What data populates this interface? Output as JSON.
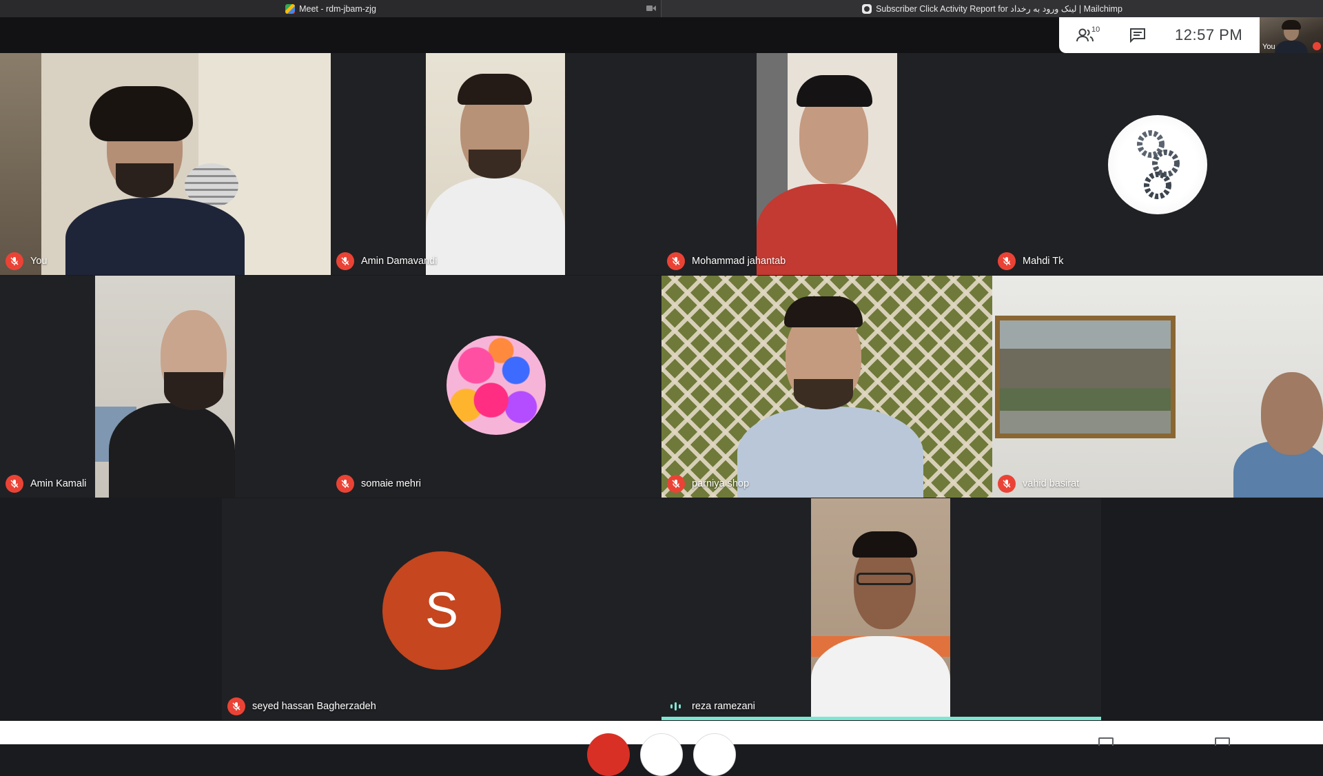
{
  "browser": {
    "tabs": [
      {
        "title": "Meet - rdm-jbam-zjg",
        "active": true
      },
      {
        "title": "Subscriber Click Activity Report for لینک ورود به رخداد | Mailchimp",
        "active": false
      }
    ]
  },
  "info_panel": {
    "participants_count": "10",
    "clock": "12:57 PM",
    "self_label": "You"
  },
  "participants": [
    {
      "name": "You",
      "muted": true
    },
    {
      "name": "Amin Damavandi",
      "muted": true
    },
    {
      "name": "Mohammad jahantab",
      "muted": true
    },
    {
      "name": "Mahdi Tk",
      "muted": true
    },
    {
      "name": "Amin Kamali",
      "muted": true
    },
    {
      "name": "somaie mehri",
      "muted": true
    },
    {
      "name": "parniya shop",
      "muted": true
    },
    {
      "name": "vahid basirat",
      "muted": true
    },
    {
      "name": "seyed hassan Bagherzadeh",
      "muted": true,
      "avatar_letter": "S"
    },
    {
      "name": "reza ramezani",
      "muted": false,
      "speaking": true
    }
  ],
  "colors": {
    "mute_red": "#ea4335",
    "speaking_teal": "#7ce8d4",
    "avatar_s": "#c5461f",
    "tile_bg": "#202124"
  },
  "icons": [
    "mic-off-icon",
    "audio-wave-icon",
    "people-icon",
    "chat-icon",
    "camera-icon"
  ]
}
